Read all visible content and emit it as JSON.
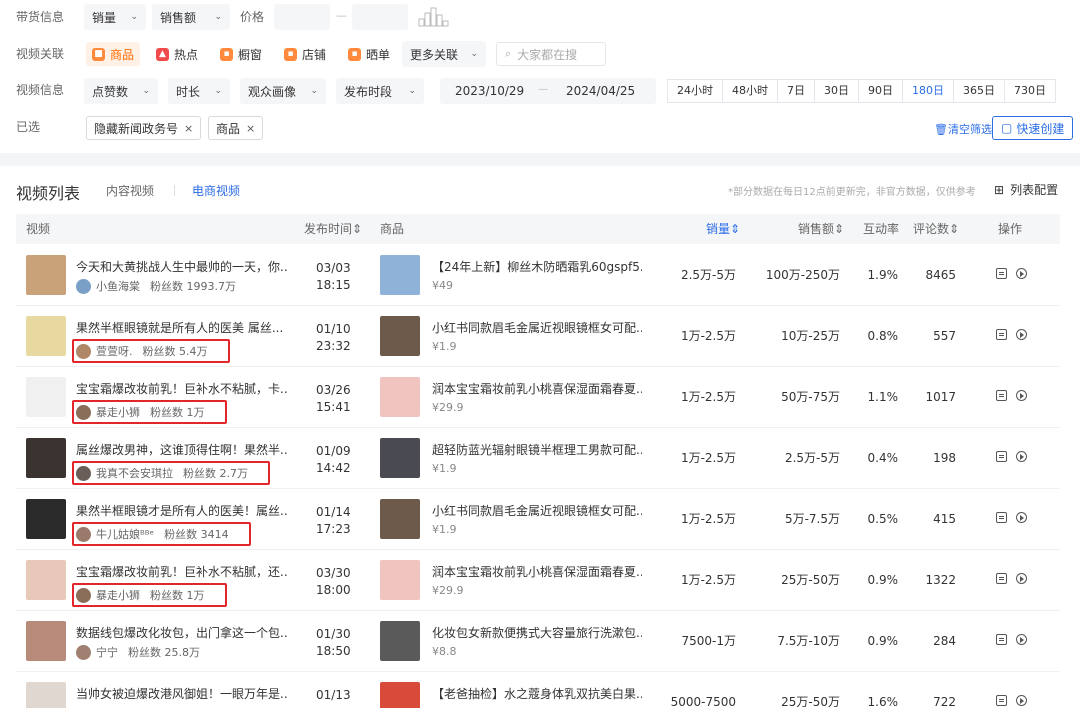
{
  "filters": {
    "goods_label": "带货信息",
    "goods_dropdowns": [
      {
        "label": "销量",
        "chevron": "chevron-down-icon"
      },
      {
        "label": "销售额",
        "chevron": "chevron-down-icon"
      }
    ],
    "price_label": "价格",
    "price_sep": "—",
    "assoc_label": "视频关联",
    "assoc_tags": [
      {
        "label": "商品",
        "icon": "product-icon",
        "color": "#ff8a3d",
        "active": true
      },
      {
        "label": "热点",
        "icon": "hot-icon",
        "color": "#f04a4a",
        "active": false
      },
      {
        "label": "橱窗",
        "icon": "window-icon",
        "color": "#ff8a3d",
        "active": false
      },
      {
        "label": "店铺",
        "icon": "store-icon",
        "color": "#ff8a3d",
        "active": false
      },
      {
        "label": "晒单",
        "icon": "share-order-icon",
        "color": "#ff8a3d",
        "active": false
      }
    ],
    "more_assoc": "更多关联",
    "search_placeholder": "大家都在搜",
    "info_label": "视频信息",
    "info_dropdowns": [
      {
        "label": "点赞数"
      },
      {
        "label": "时长"
      },
      {
        "label": "观众画像"
      },
      {
        "label": "发布时段"
      }
    ],
    "date_start": "2023/10/29",
    "date_sep": "—",
    "date_end": "2024/04/25",
    "ranges": [
      {
        "label": "24小时",
        "active": false
      },
      {
        "label": "48小时",
        "active": false
      },
      {
        "label": "7日",
        "active": false
      },
      {
        "label": "30日",
        "active": false
      },
      {
        "label": "90日",
        "active": false
      },
      {
        "label": "180日",
        "active": true
      },
      {
        "label": "365日",
        "active": false
      },
      {
        "label": "730日",
        "active": false
      }
    ],
    "selected_label": "已选",
    "chips": [
      {
        "label": "隐藏新闻政务号",
        "x": "×"
      },
      {
        "label": "商品",
        "x": "×"
      }
    ],
    "clear_all": "清空筛选",
    "quick_create": "快速创建"
  },
  "list": {
    "title": "视频列表",
    "tabs": [
      {
        "label": "内容视频",
        "active": false
      },
      {
        "label": "电商视频",
        "active": true
      }
    ],
    "note": "*部分数据在每日12点前更新完，非官方数据，仅供参考",
    "column_config": "列表配置",
    "headers": {
      "video": "视频",
      "publish_time": "发布时间",
      "product": "商品",
      "sales": "销量",
      "revenue": "销售额",
      "interaction": "互动率",
      "comments": "评论数",
      "actions": "操作"
    },
    "sort_icon": "sort-icon",
    "rows": [
      {
        "title": "今天和大黄挑战人生中最帅的一天，你...",
        "author": "小鱼海棠",
        "fans": "粉丝数 1993.7万",
        "date": "03/03",
        "time": "18:15",
        "product": "【24年上新】柳丝木防晒霜乳60gspf5...",
        "price": "¥49",
        "sales": "2.5万-5万",
        "revenue": "100万-250万",
        "rate": "1.9%",
        "comments": "8465",
        "highlight": false,
        "thumb_color": "#c9a27a",
        "prod_color": "#8fb2d8",
        "avatar_color": "#7aa0c8"
      },
      {
        "title": "果然半框眼镜就是所有人的医美 属丝...",
        "author": "萱萱呀.",
        "fans": "粉丝数 5.4万",
        "date": "01/10",
        "time": "23:32",
        "product": "小红书同款眉毛金属近视眼镜框女可配...",
        "price": "¥1.9",
        "sales": "1万-2.5万",
        "revenue": "10万-25万",
        "rate": "0.8%",
        "comments": "557",
        "highlight": true,
        "thumb_color": "#e8d9a0",
        "prod_color": "#6d5a4a",
        "avatar_color": "#b08868"
      },
      {
        "title": "宝宝霜爆改妆前乳！巨补水不粘腻，卡...",
        "author": "暴走小狮",
        "fans": "粉丝数 1万",
        "date": "03/26",
        "time": "15:41",
        "product": "润本宝宝霜妆前乳小桃喜保湿面霜春夏...",
        "price": "¥29.9",
        "sales": "1万-2.5万",
        "revenue": "50万-75万",
        "rate": "1.1%",
        "comments": "1017",
        "highlight": true,
        "thumb_color": "#f0f0f0",
        "prod_color": "#f2c4c0",
        "avatar_color": "#8a6e5a"
      },
      {
        "title": "属丝爆改男神，这谁顶得住啊！果然半...",
        "author": "我真不会安琪拉",
        "fans": "粉丝数 2.7万",
        "date": "01/09",
        "time": "14:42",
        "product": "超轻防蓝光辐射眼镜半框理工男款可配...",
        "price": "¥1.9",
        "sales": "1万-2.5万",
        "revenue": "2.5万-5万",
        "rate": "0.4%",
        "comments": "198",
        "highlight": true,
        "thumb_color": "#3a3330",
        "prod_color": "#4a4a52",
        "avatar_color": "#6a5f58"
      },
      {
        "title": "果然半框眼镜才是所有人的医美！属丝...",
        "author": "牛儿姑娘ᴮᴮᵉ",
        "fans": "粉丝数 3414",
        "date": "01/14",
        "time": "17:23",
        "product": "小红书同款眉毛金属近视眼镜框女可配...",
        "price": "¥1.9",
        "sales": "1万-2.5万",
        "revenue": "5万-7.5万",
        "rate": "0.5%",
        "comments": "415",
        "highlight": true,
        "thumb_color": "#2a2a2a",
        "prod_color": "#6d5a4a",
        "avatar_color": "#9a7a6a"
      },
      {
        "title": "宝宝霜爆改妆前乳！巨补水不粘腻，还...",
        "author": "暴走小狮",
        "fans": "粉丝数 1万",
        "date": "03/30",
        "time": "18:00",
        "product": "润本宝宝霜妆前乳小桃喜保湿面霜春夏...",
        "price": "¥29.9",
        "sales": "1万-2.5万",
        "revenue": "25万-50万",
        "rate": "0.9%",
        "comments": "1322",
        "highlight": true,
        "thumb_color": "#e8c8b8",
        "prod_color": "#f2c4c0",
        "avatar_color": "#8a6e5a"
      },
      {
        "title": "数据线包爆改化妆包，出门拿这一个包...",
        "author": "宁宁",
        "fans": "粉丝数 25.8万",
        "date": "01/30",
        "time": "18:50",
        "product": "化妆包女新款便携式大容量旅行洗漱包...",
        "price": "¥8.8",
        "sales": "7500-1万",
        "revenue": "7.5万-10万",
        "rate": "0.9%",
        "comments": "284",
        "highlight": false,
        "thumb_color": "#b88a7a",
        "prod_color": "#5a5a5a",
        "avatar_color": "#a08070"
      },
      {
        "title": "当帅女被迫爆改港风御姐！一眼万年是...",
        "author": "",
        "fans": "",
        "date": "01/13",
        "time": "",
        "product": "【老爸抽检】水之蔻身体乳双抗美白果...",
        "price": "",
        "sales": "5000-7500",
        "revenue": "25万-50万",
        "rate": "1.6%",
        "comments": "722",
        "highlight": false,
        "thumb_color": "#e0d8d0",
        "prod_color": "#d84a3a",
        "avatar_color": "#999999"
      }
    ],
    "action_icons": [
      "detail-icon",
      "play-icon"
    ]
  },
  "colors": {
    "accent": "#2b6de5",
    "orange": "#ff6a00",
    "highlight_box": "#e2262a"
  }
}
